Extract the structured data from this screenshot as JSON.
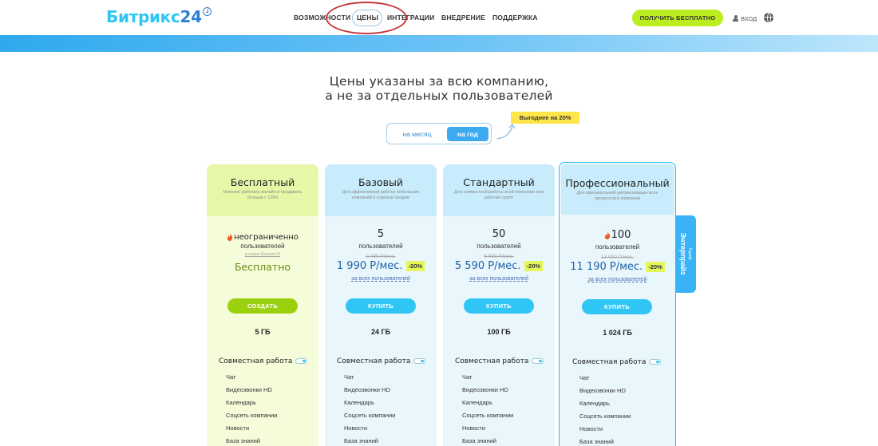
{
  "header": {
    "logo_text": "Битрикс",
    "logo_num": "24",
    "nav": [
      "ВОЗМОЖНОСТИ",
      "ЦЕНЫ",
      "ИНТЕГРАЦИИ",
      "ВНЕДРЕНИЕ",
      "ПОДДЕРЖКА"
    ],
    "cta_label": "ПОЛУЧИТЬ БЕСПЛАТНО",
    "login_label": "ВХОД"
  },
  "hero": {
    "line1": "Цены указаны за всю компанию,",
    "line2": "а не за отдельных пользователей"
  },
  "billing": {
    "month_label": "на месяц",
    "year_label": "на год",
    "badge": "Выгоднее на 20%"
  },
  "side_tab": {
    "small": "Тариф",
    "label": "Энтерпрайз"
  },
  "plans": [
    {
      "title": "Бесплатный",
      "desc": "Начните работать онлайн и продавать больше с CRM",
      "users_num": "неограниченно",
      "users_label": "пользователей",
      "note": "условия Битрикс24",
      "price": "Бесплатно",
      "button": "СОЗДАТЬ",
      "storage": "5 ГБ",
      "collab": "Совместная работа",
      "features": [
        "Чат",
        "Видеозвонки HD",
        "Календарь",
        "Соцсеть компании",
        "Новости",
        "База знаний"
      ]
    },
    {
      "title": "Базовый",
      "desc": "Для эффективной работы небольших компаний и отделов продаж",
      "users_num": "5",
      "users_label": "пользователей",
      "old_price": "2 490 Р/мес.",
      "price": "1 990 Р/мес.",
      "discount": "-20%",
      "price_sub": "за всех пользователей",
      "button": "КУПИТЬ",
      "storage": "24 ГБ",
      "collab": "Совместная работа",
      "features": [
        "Чат",
        "Видеозвонки HD",
        "Календарь",
        "Соцсеть компании",
        "Новости",
        "База знаний"
      ]
    },
    {
      "title": "Стандартный",
      "desc": "Для совместной работы всей компании или рабочих групп",
      "users_num": "50",
      "users_label": "пользователей",
      "old_price": "6 990 Р/мес.",
      "price": "5 590 Р/мес.",
      "discount": "-20%",
      "price_sub": "за всех пользователей",
      "button": "КУПИТЬ",
      "storage": "100 ГБ",
      "collab": "Совместная работа",
      "features": [
        "Чат",
        "Видеозвонки HD",
        "Календарь",
        "Соцсеть компании",
        "Новости",
        "База знаний"
      ]
    },
    {
      "title": "Профессиональный",
      "desc": "Для максимальной автоматизации всех процессов в компании",
      "users_num": "100",
      "users_label": "пользователей",
      "old_price": "13 990 Р/мес.",
      "price": "11 190 Р/мес.",
      "discount": "-20%",
      "price_sub": "за всех пользователей",
      "button": "КУПИТЬ",
      "storage": "1 024 ГБ",
      "collab": "Совместная работа",
      "features": [
        "Чат",
        "Видеозвонки HD",
        "Календарь",
        "Соцсеть компании",
        "Новости",
        "База знаний"
      ]
    }
  ],
  "colors": {
    "accent_green": "#bbed21",
    "accent_blue": "#2fc6f6",
    "annotation_red": "#c53a3a"
  }
}
